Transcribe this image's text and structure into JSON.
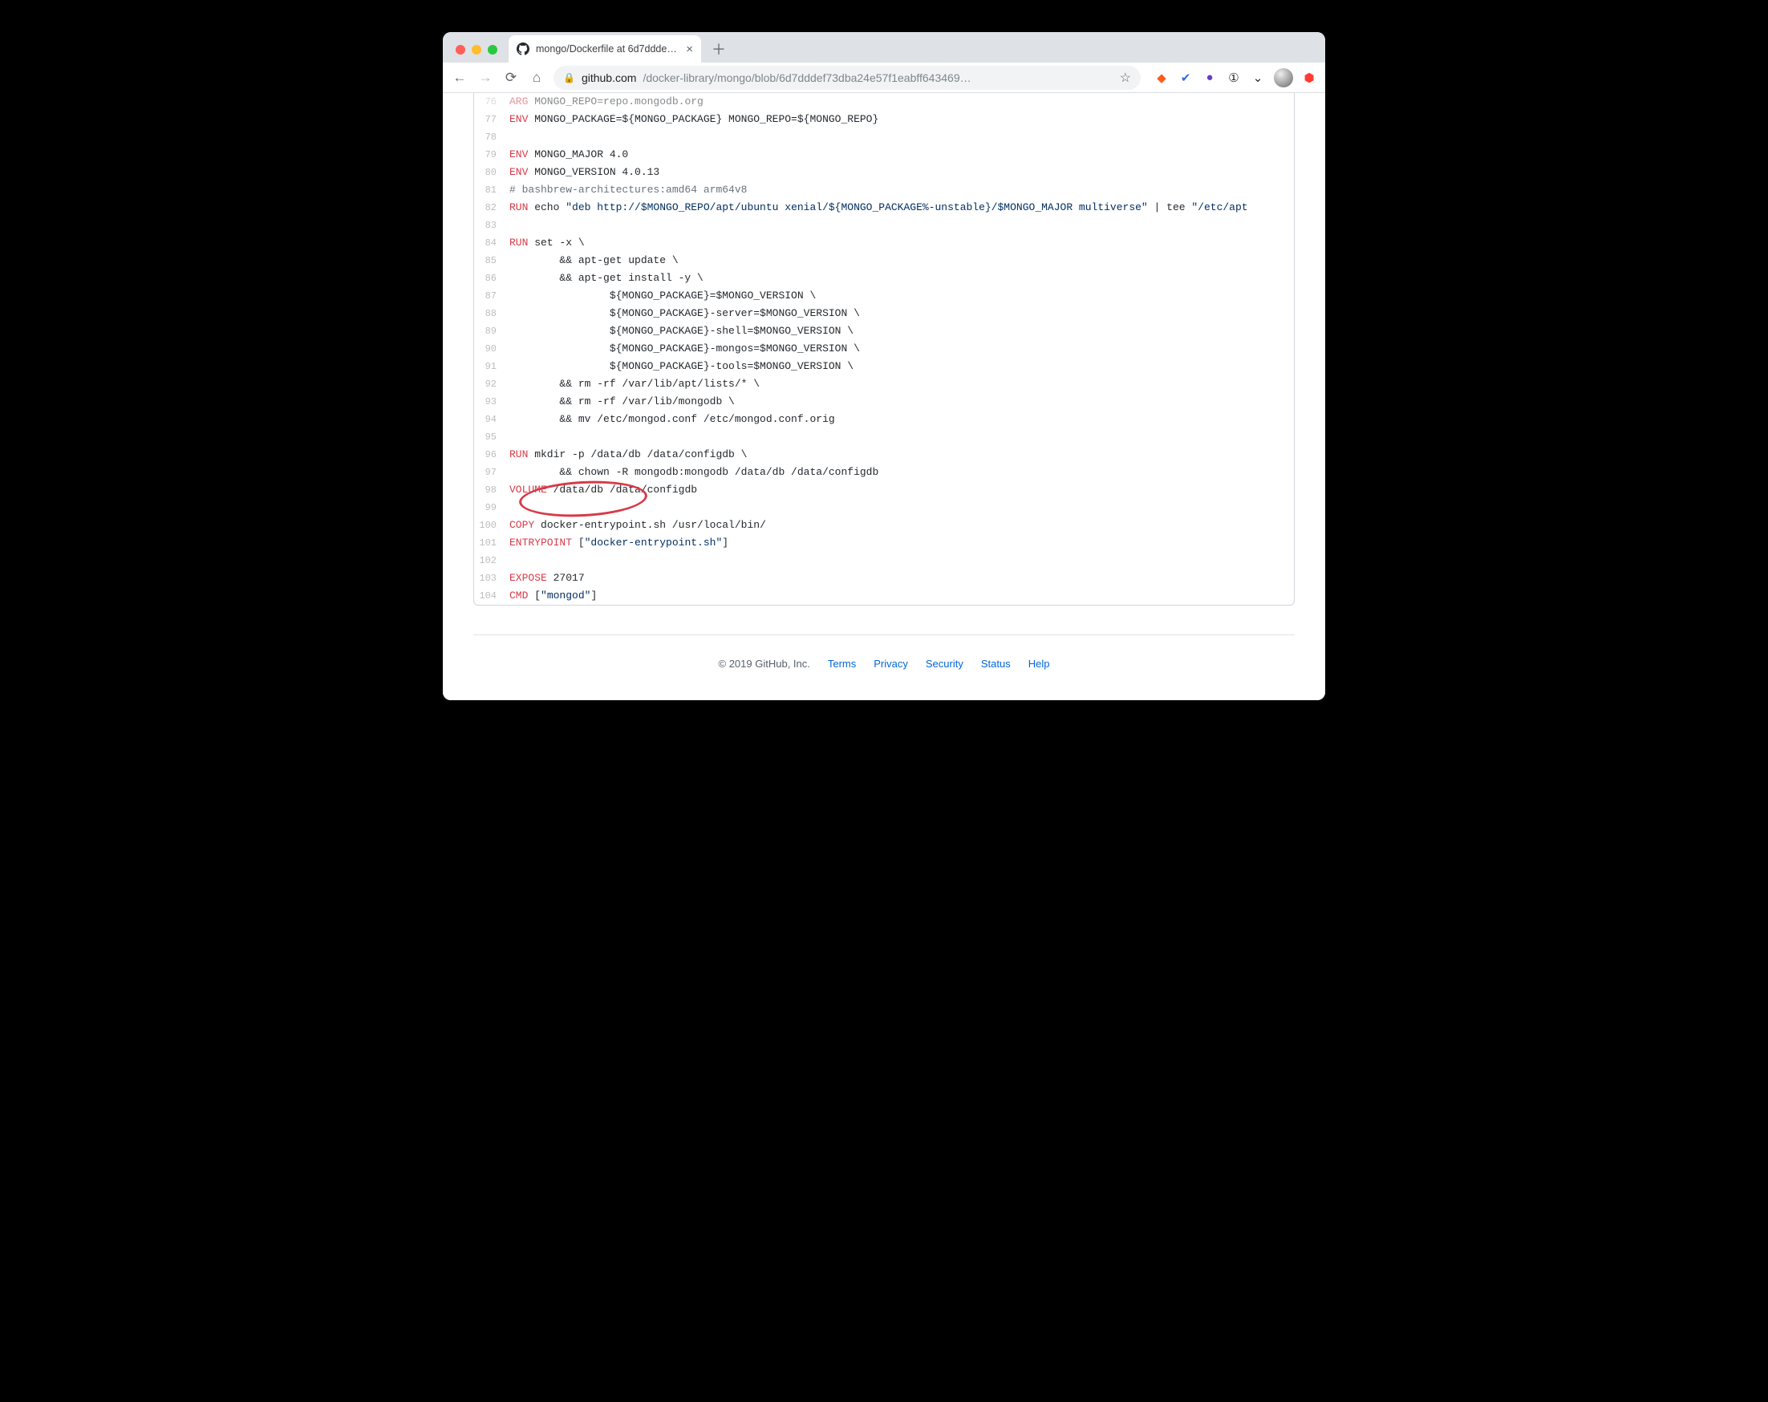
{
  "window": {
    "traffic": {
      "close": "#ff5f57",
      "min": "#febc2e",
      "max": "#28c840"
    }
  },
  "tab": {
    "title": "mongo/Dockerfile at 6d7dddef…"
  },
  "toolbar": {
    "url_domain": "github.com",
    "url_path": "/docker-library/mongo/blob/6d7dddef73dba24e57f1eabff643469…"
  },
  "ext": {
    "e1_color": "#ff5c1a",
    "e2_color": "#2a6fdb",
    "e3_color": "#6a3cc9",
    "e4_color": "#262626",
    "e5_color": "#262626",
    "e6_color": "#ff3b30"
  },
  "code": {
    "lines": [
      {
        "n": 76,
        "t": "keyword",
        "k": "ARG",
        "rest": " MONGO_REPO=repo.mongodb.org",
        "faded": true
      },
      {
        "n": 77,
        "t": "keyword",
        "k": "ENV",
        "rest": " MONGO_PACKAGE=${MONGO_PACKAGE} MONGO_REPO=${MONGO_REPO}"
      },
      {
        "n": 78,
        "t": "blank"
      },
      {
        "n": 79,
        "t": "keyword",
        "k": "ENV",
        "rest": " MONGO_MAJOR 4.0"
      },
      {
        "n": 80,
        "t": "keyword",
        "k": "ENV",
        "rest": " MONGO_VERSION 4.0.13"
      },
      {
        "n": 81,
        "t": "comment",
        "text": "# bashbrew-architectures:amd64 arm64v8"
      },
      {
        "n": 82,
        "t": "run_echo",
        "k": "RUN",
        "a": " echo ",
        "s": "\"deb http://$MONGO_REPO/apt/ubuntu xenial/${MONGO_PACKAGE%-unstable}/$MONGO_MAJOR multiverse\"",
        "b": " | tee ",
        "s2": "\"/etc/apt"
      },
      {
        "n": 83,
        "t": "blank"
      },
      {
        "n": 84,
        "t": "keyword",
        "k": "RUN",
        "rest": " set -x \\"
      },
      {
        "n": 85,
        "t": "plain",
        "text": "        && apt-get update \\"
      },
      {
        "n": 86,
        "t": "plain",
        "text": "        && apt-get install -y \\"
      },
      {
        "n": 87,
        "t": "plain",
        "text": "                ${MONGO_PACKAGE}=$MONGO_VERSION \\"
      },
      {
        "n": 88,
        "t": "plain",
        "text": "                ${MONGO_PACKAGE}-server=$MONGO_VERSION \\"
      },
      {
        "n": 89,
        "t": "plain",
        "text": "                ${MONGO_PACKAGE}-shell=$MONGO_VERSION \\"
      },
      {
        "n": 90,
        "t": "plain",
        "text": "                ${MONGO_PACKAGE}-mongos=$MONGO_VERSION \\"
      },
      {
        "n": 91,
        "t": "plain",
        "text": "                ${MONGO_PACKAGE}-tools=$MONGO_VERSION \\"
      },
      {
        "n": 92,
        "t": "plain",
        "text": "        && rm -rf /var/lib/apt/lists/* \\"
      },
      {
        "n": 93,
        "t": "plain",
        "text": "        && rm -rf /var/lib/mongodb \\"
      },
      {
        "n": 94,
        "t": "plain",
        "text": "        && mv /etc/mongod.conf /etc/mongod.conf.orig"
      },
      {
        "n": 95,
        "t": "blank"
      },
      {
        "n": 96,
        "t": "keyword",
        "k": "RUN",
        "rest": " mkdir -p /data/db /data/configdb \\"
      },
      {
        "n": 97,
        "t": "plain",
        "text": "        && chown -R mongodb:mongodb /data/db /data/configdb"
      },
      {
        "n": 98,
        "t": "keyword",
        "k": "VOLUME",
        "rest": " /data/db /data/configdb"
      },
      {
        "n": 99,
        "t": "blank"
      },
      {
        "n": 100,
        "t": "keyword",
        "k": "COPY",
        "rest": " docker-entrypoint.sh /usr/local/bin/"
      },
      {
        "n": 101,
        "t": "kw_str",
        "k": "ENTRYPOINT",
        "a": " [",
        "s": "\"docker-entrypoint.sh\"",
        "b": "]"
      },
      {
        "n": 102,
        "t": "blank"
      },
      {
        "n": 103,
        "t": "keyword",
        "k": "EXPOSE",
        "rest": " 27017"
      },
      {
        "n": 104,
        "t": "kw_str",
        "k": "CMD",
        "a": " [",
        "s": "\"mongod\"",
        "b": "]"
      }
    ]
  },
  "footer": {
    "copyright": "© 2019 GitHub, Inc.",
    "links": [
      "Terms",
      "Privacy",
      "Security",
      "Status",
      "Help"
    ]
  }
}
